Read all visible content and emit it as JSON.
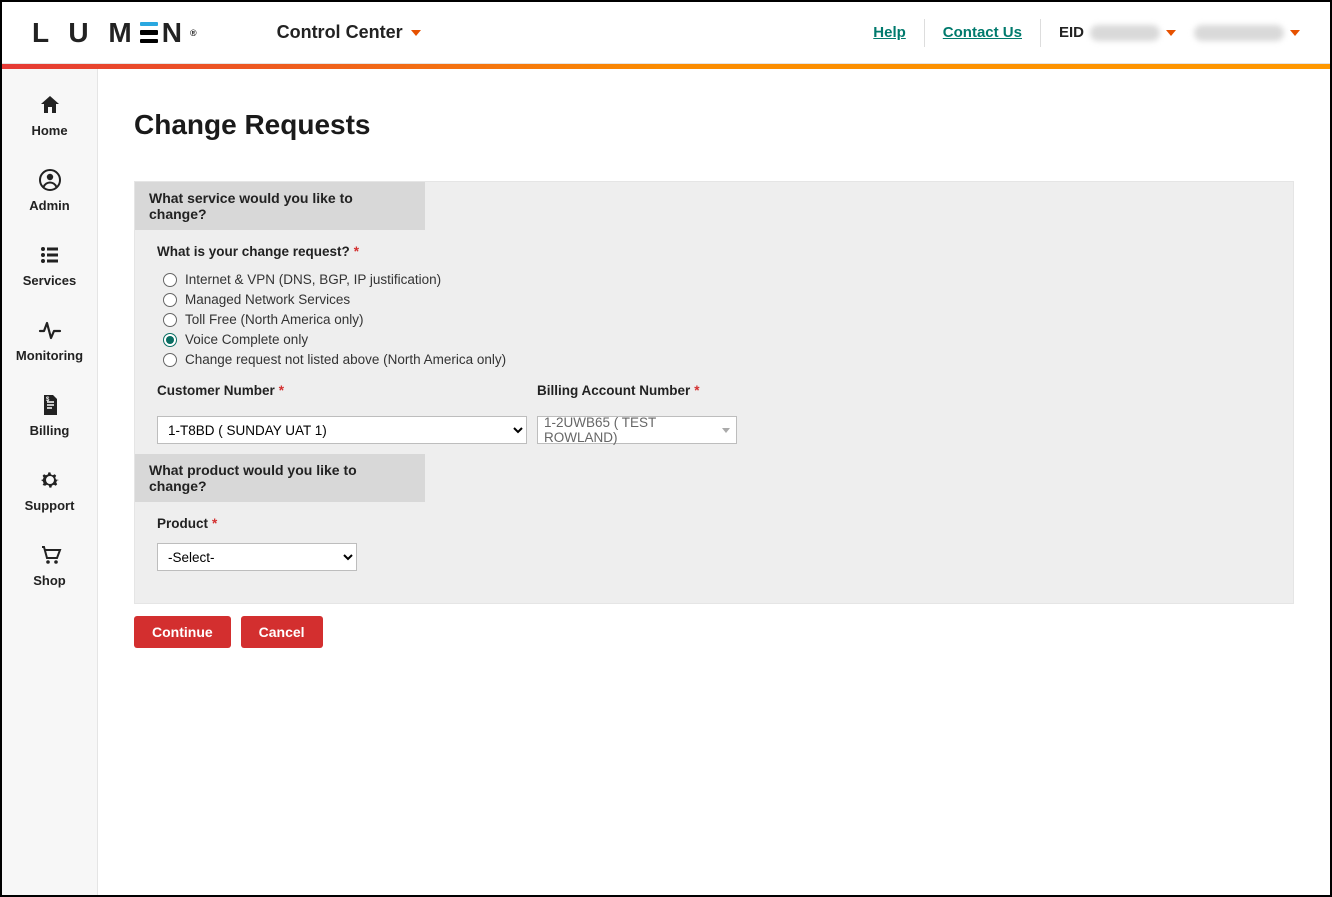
{
  "header": {
    "logo_text": "LUMEN",
    "control_center_label": "Control Center",
    "help_label": "Help",
    "contact_label": "Contact Us",
    "eid_label": "EID"
  },
  "sidebar": {
    "items": [
      {
        "label": "Home",
        "icon": "home-icon"
      },
      {
        "label": "Admin",
        "icon": "user-icon"
      },
      {
        "label": "Services",
        "icon": "list-icon"
      },
      {
        "label": "Monitoring",
        "icon": "activity-icon"
      },
      {
        "label": "Billing",
        "icon": "invoice-icon"
      },
      {
        "label": "Support",
        "icon": "gear-icon"
      },
      {
        "label": "Shop",
        "icon": "cart-icon"
      }
    ]
  },
  "page": {
    "title": "Change Requests",
    "section1_header": "What service would you like to change?",
    "section2_header": "What product would you like to change?",
    "change_request_label": "What is your change request?",
    "radio_options": [
      "Internet & VPN (DNS, BGP, IP justification)",
      "Managed Network Services",
      "Toll Free (North America only)",
      "Voice Complete only",
      "Change request not listed above (North America only)"
    ],
    "radio_selected_index": 3,
    "customer_number_label": "Customer Number",
    "customer_number_value": "1-T8BD ( SUNDAY UAT 1)",
    "billing_account_label": "Billing Account Number",
    "billing_account_value": "1-2UWB65 ( TEST ROWLAND)",
    "product_label": "Product",
    "product_value": "-Select-",
    "continue_label": "Continue",
    "cancel_label": "Cancel"
  }
}
